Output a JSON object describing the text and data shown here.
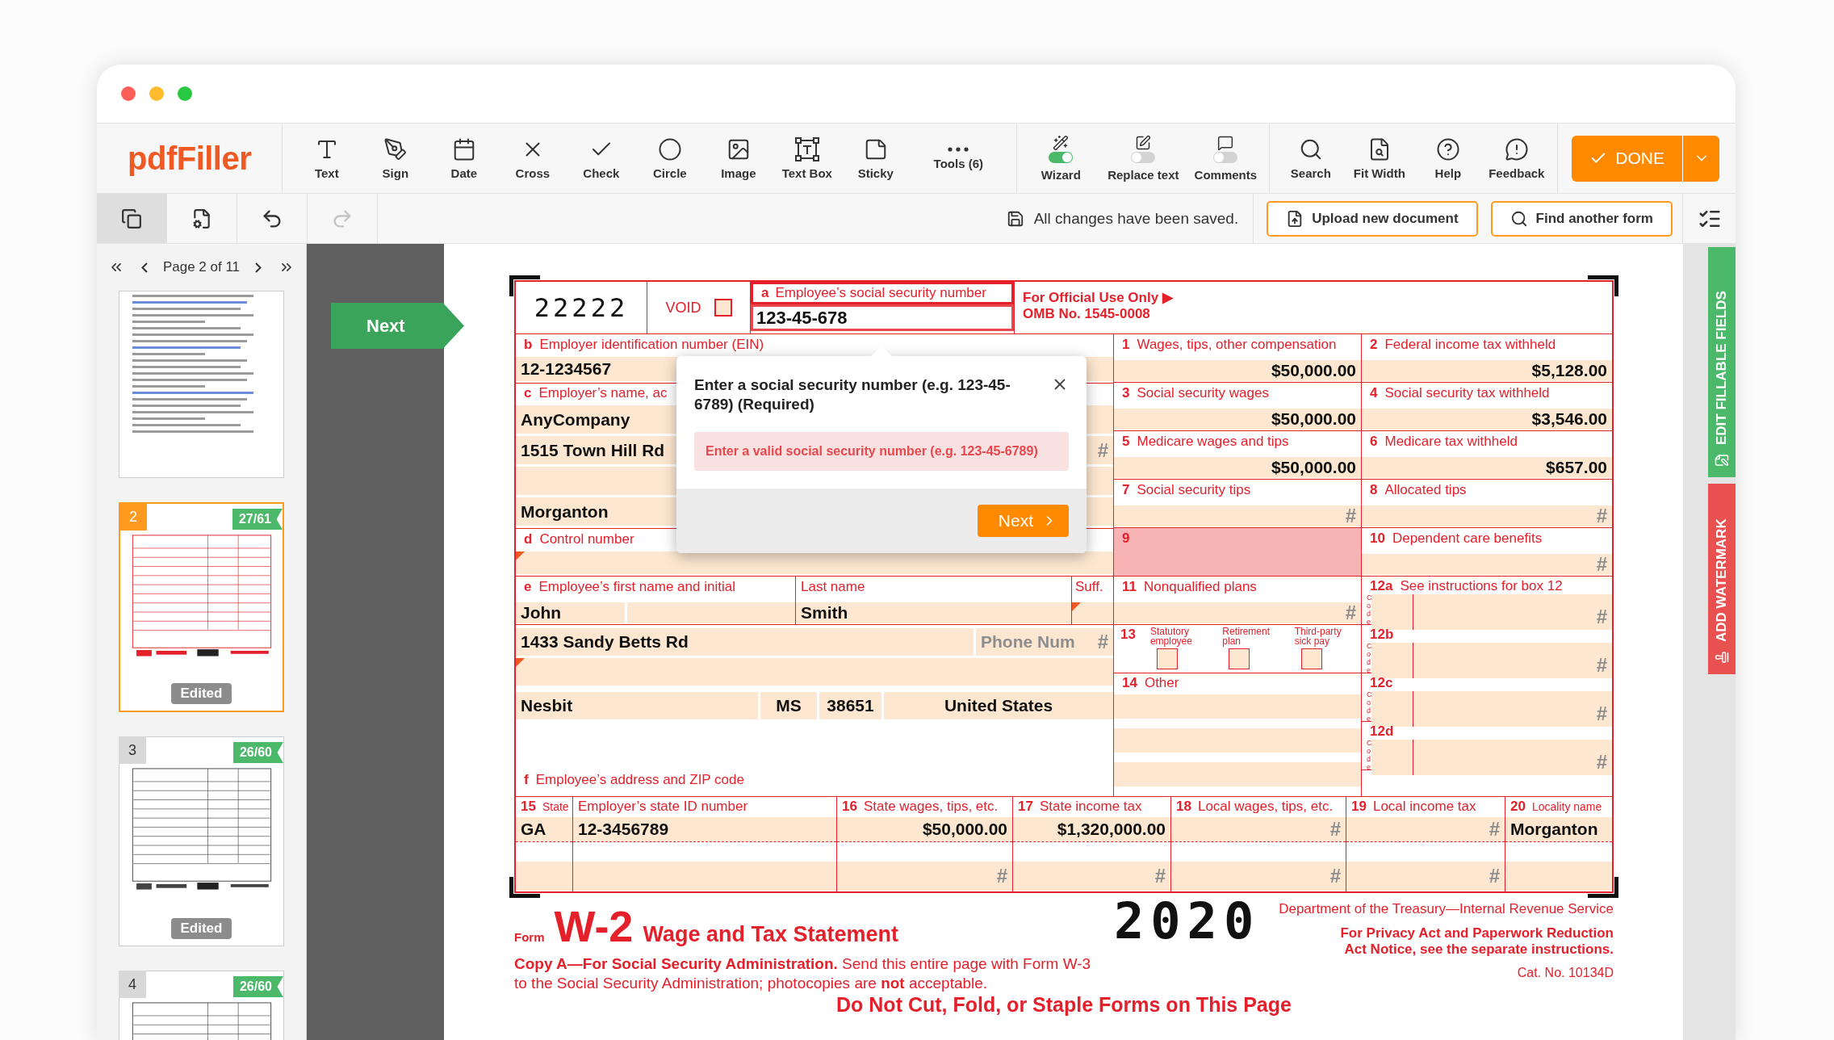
{
  "app": {
    "logo": "pdfFiller"
  },
  "toolbar": {
    "tools": [
      {
        "label": "Text"
      },
      {
        "label": "Sign"
      },
      {
        "label": "Date"
      },
      {
        "label": "Cross"
      },
      {
        "label": "Check"
      },
      {
        "label": "Circle"
      },
      {
        "label": "Image"
      },
      {
        "label": "Text Box"
      },
      {
        "label": "Sticky"
      },
      {
        "label": "Tools (6)"
      }
    ],
    "toggles": [
      {
        "label": "Wizard",
        "on": true
      },
      {
        "label": "Replace text",
        "on": false
      },
      {
        "label": "Comments",
        "on": false
      }
    ],
    "actions": [
      {
        "label": "Search"
      },
      {
        "label": "Fit Width"
      },
      {
        "label": "Help"
      },
      {
        "label": "Feedback"
      }
    ],
    "done": "DONE"
  },
  "subbar": {
    "views": [
      {
        "selected": true
      },
      {
        "selected": false
      }
    ],
    "undo": {
      "disabled": false
    },
    "redo": {
      "disabled": true
    },
    "status": "All changes have been saved.",
    "buttons": [
      {
        "label": "Upload new document"
      },
      {
        "label": "Find another form"
      }
    ]
  },
  "sidebar": {
    "pager": "Page 2 of 11",
    "pages": [
      {
        "kind": "text",
        "selected": false
      },
      {
        "kind": "redform",
        "number": "2",
        "selected": true,
        "progress": "27/61",
        "badge": "Edited"
      },
      {
        "kind": "form",
        "number": "3",
        "selected": false,
        "progress": "26/60",
        "badge": "Edited"
      },
      {
        "kind": "form",
        "number": "4",
        "selected": false,
        "progress": "26/60"
      }
    ]
  },
  "next_tag": "Next",
  "side_tabs": [
    {
      "label": "EDIT FILLABLE FIELDS",
      "color": "#4cb86a"
    },
    {
      "label": "ADD WATERMARK",
      "color": "#e8514f"
    }
  ],
  "form": {
    "control_code": "22222",
    "void": {
      "label": "VOID",
      "checked": false
    },
    "ssn": {
      "letter": "a",
      "label": "Employee’s social security number",
      "value": "123-45-678",
      "invalid": true
    },
    "official": {
      "title": "For Official Use Only ▶",
      "omb": "OMB No. 1545-0008"
    },
    "ein": {
      "letter": "b",
      "label": "Employer identification number (EIN)",
      "value": "12-1234567"
    },
    "employer": {
      "letter": "c",
      "label": "Employer’s name, ac",
      "lines": [
        {
          "kind": "text",
          "value": "AnyCompany"
        },
        {
          "kind": "text",
          "value": "1515 Town Hill Rd",
          "mark": "#"
        },
        {
          "kind": "blank"
        },
        {
          "kind": "text",
          "value": "Morganton"
        }
      ]
    },
    "control": {
      "letter": "d",
      "label": "Control number"
    },
    "employee": {
      "letter": "e",
      "first_label": "Employee’s first name and initial",
      "first": "John",
      "last_label": "Last name",
      "last": "Smith",
      "suffix_label": "Suff.",
      "street": "1433 Sandy Betts Rd",
      "phone": {
        "placeholder": "Phone Num",
        "mark": "#"
      },
      "city": "Nesbit",
      "state": "MS",
      "zip": "38651",
      "country": "United States",
      "address_letter": "f",
      "address_label": "Employee’s address and ZIP code"
    },
    "middle_boxes": [
      {
        "number": "1",
        "label": "Wages, tips, other compensation",
        "value": "$50,000.00"
      },
      {
        "number": "3",
        "label": "Social security wages",
        "value": "$50,000.00"
      },
      {
        "number": "5",
        "label": "Medicare wages and tips",
        "value": "$50,000.00"
      },
      {
        "number": "7",
        "label": "Social security tips",
        "placeholder": "#"
      },
      {
        "number": "9",
        "shaded": true
      },
      {
        "number": "11",
        "label": "Nonqualified plans",
        "placeholder": "#"
      }
    ],
    "box13": {
      "number": "13",
      "options": [
        {
          "label": "Statutory employee",
          "checked": false
        },
        {
          "label": "Retirement plan",
          "checked": false
        },
        {
          "label": "Third-party sick pay",
          "checked": false
        }
      ]
    },
    "box14": {
      "number": "14",
      "label": "Other"
    },
    "right_boxes": [
      {
        "kind": "amount",
        "number": "2",
        "label": "Federal income tax withheld",
        "value": "$5,128.00"
      },
      {
        "kind": "amount",
        "number": "4",
        "label": "Social security tax withheld",
        "value": "$3,546.00"
      },
      {
        "kind": "amount",
        "number": "6",
        "label": "Medicare tax withheld",
        "value": "$657.00"
      },
      {
        "kind": "amount",
        "number": "8",
        "label": "Allocated tips",
        "placeholder": "#"
      },
      {
        "kind": "amount",
        "number": "10",
        "label": "Dependent care benefits",
        "placeholder": "#"
      },
      {
        "kind": "code",
        "number": "12a",
        "label": "See instructions for box 12",
        "code": "Code",
        "placeholder": "#"
      },
      {
        "kind": "code",
        "number": "12b",
        "code": "Code",
        "placeholder": "#"
      },
      {
        "kind": "code",
        "number": "12c",
        "code": "Code",
        "placeholder": "#"
      },
      {
        "kind": "code",
        "number": "12d",
        "code": "Code",
        "placeholder": "#"
      }
    ],
    "state_columns": [
      {
        "number": "15",
        "label": "State",
        "cells": [
          {
            "value": "GA"
          },
          {}
        ]
      },
      {
        "label": "Employer’s state ID number",
        "cells": [
          {
            "value": "12-3456789"
          },
          {}
        ]
      },
      {
        "number": "16",
        "label": "State wages, tips, etc.",
        "cells": [
          {
            "value": "$50,000.00"
          },
          {
            "placeholder": "#"
          }
        ]
      },
      {
        "number": "17",
        "label": "State income tax",
        "cells": [
          {
            "value": "$1,320,000.00"
          },
          {
            "placeholder": "#"
          }
        ]
      },
      {
        "number": "18",
        "label": "Local wages, tips, etc.",
        "cells": [
          {
            "placeholder": "#"
          },
          {
            "placeholder": "#"
          }
        ]
      },
      {
        "number": "19",
        "label": "Local income tax",
        "cells": [
          {
            "placeholder": "#"
          },
          {
            "placeholder": "#"
          }
        ]
      },
      {
        "number": "20",
        "label": "Locality name",
        "cells": [
          {
            "value": "Morganton"
          },
          {}
        ]
      }
    ],
    "footer": {
      "form_word": "Form",
      "form_name": "W-2",
      "title": "Wage and Tax Statement",
      "year": "2020",
      "copy": "**Copy A—For Social Security Administration.** Send this entire page with Form W-3 to the Social Security Administration; photocopies are **not** acceptable.",
      "department": "Department of the Treasury—Internal Revenue Service",
      "privacy": "For Privacy Act and Paperwork Reduction Act Notice, see the separate instructions.",
      "catalog": "Cat. No. 10134D",
      "warning": "Do Not Cut, Fold, or Staple Forms on This Page"
    }
  },
  "popup": {
    "title": "Enter a social security number (e.g. 123-45-6789) (Required)",
    "error": "Enter a valid social security number (e.g. 123-45-6789)",
    "button": "Next"
  }
}
